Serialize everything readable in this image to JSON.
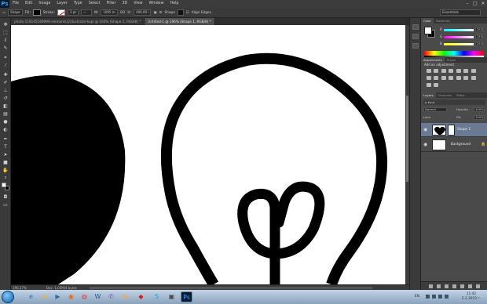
{
  "app": {
    "logo": "Ps",
    "menu": [
      "File",
      "Edit",
      "Image",
      "Layer",
      "Type",
      "Select",
      "Filter",
      "3D",
      "View",
      "Window",
      "Help"
    ],
    "window_controls": [
      "–",
      "□",
      "✕"
    ]
  },
  "options_bar": {
    "mode": "Shape",
    "fill_label": "Fill:",
    "stroke_label": "Stroke:",
    "stroke_width": "3 pt",
    "w_value": "1095 m",
    "go": "GO",
    "h_value": "400,00 i",
    "path_mode": "Shape",
    "align_edges": "Align Edges",
    "workspace": "Essentials"
  },
  "document_tabs": [
    {
      "label": "photo-118145169999-elements(2)Ilustrator-kopi @ 100% (Shape 1, RGB/8) *",
      "active": false
    },
    {
      "label": "Untitled-1 @ 196% (Shape 1, RGB/8) *",
      "active": true
    }
  ],
  "status": {
    "zoom": "196,37%",
    "doc": "Doc: 1,05M/4 bytes"
  },
  "color_panel": {
    "tabs": [
      "Color",
      "Swatches"
    ],
    "sliders": [
      {
        "label": "R",
        "value": "255",
        "gradient": "linear-gradient(to right,#00ffff,#ffffff)"
      },
      {
        "label": "G",
        "value": "255",
        "gradient": "linear-gradient(to right,#ff00ff,#ffffff)"
      },
      {
        "label": "B",
        "value": "255",
        "gradient": "linear-gradient(to right,#ffff00,#ffffff)"
      }
    ]
  },
  "adjustments_panel": {
    "tabs": [
      "Adjustments",
      "Styles"
    ],
    "title": "Add an adjustment"
  },
  "layers_panel": {
    "tabs": [
      "Layers",
      "Channels",
      "Paths"
    ],
    "kind": "ρ Kind",
    "blend_mode": "Normal",
    "opacity_label": "Opacity:",
    "opacity": "100%",
    "lock_label": "Lock:",
    "fill_label": "Fill:",
    "fill": "100%",
    "layers": [
      {
        "name": "Shape 1",
        "selected": true
      },
      {
        "name": "Background",
        "selected": false
      }
    ]
  },
  "taskbar": {
    "apps": [
      "ie-icon",
      "folder-icon",
      "media-icon",
      "firefox-icon",
      "chrome-icon",
      "word-icon",
      "viber-icon",
      "files-icon",
      "stamp-icon",
      "skype-icon",
      "unknown-icon",
      "photoshop-icon"
    ],
    "language": "EN",
    "time": "11:42",
    "date": "2.2.2015 г."
  }
}
